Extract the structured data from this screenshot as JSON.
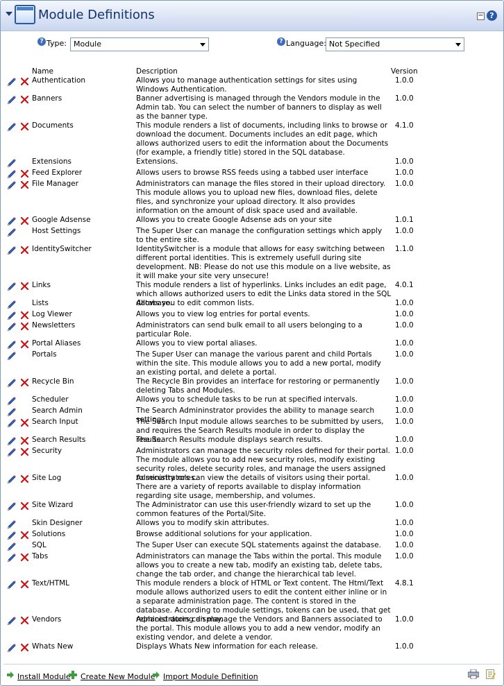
{
  "header": {
    "title": "Module Definitions",
    "minimize_label": "−",
    "help_label": "?"
  },
  "filters": {
    "type_label": "Type:",
    "type_value": "Module",
    "language_label": "Language:",
    "language_value": "Not Specified",
    "help_glyph": "?"
  },
  "columns": {
    "name": "Name",
    "description": "Description",
    "version": "Version"
  },
  "modules": [
    {
      "name": "Authentication",
      "description": "Allows you to manage authentication settings for sites using Windows Authentication.",
      "version": "1.0.0",
      "deletable": true
    },
    {
      "name": "Banners",
      "description": "Banner advertising is managed through the Vendors module in the Admin tab. You can select the number of banners to display as well as the banner type.",
      "version": "1.0.0",
      "deletable": true
    },
    {
      "name": "Documents",
      "description": "This module renders a list of documents, including links to browse or download the document. Documents includes an edit page, which allows authorized users to edit the information about the Documents (for example, a friendly title) stored in the SQL database.",
      "version": "4.1.0",
      "deletable": true
    },
    {
      "name": "Extensions",
      "description": "Extensions.",
      "version": "1.0.0",
      "deletable": false
    },
    {
      "name": "Feed Explorer",
      "description": "Allows users to browse RSS feeds using a tabbed user interface",
      "version": "1.0.0",
      "deletable": true
    },
    {
      "name": "File Manager",
      "description": "Administrators can manage the files stored in their upload directory. This module allows you to upload new files, download files, delete files, and synchronize your upload directory. It also provides information on the amount of disk space used and available.",
      "version": "1.0.0",
      "deletable": true
    },
    {
      "name": "Google Adsense",
      "description": "Allows you to create Google Adsense ads on your site",
      "version": "1.0.1",
      "deletable": true
    },
    {
      "name": "Host Settings",
      "description": "The Super User can manage the configuration settings which apply to the entire site.",
      "version": "1.0.0",
      "deletable": false
    },
    {
      "name": "IdentitySwitcher",
      "description": "IdentitySwitcher is a module that allows for easy switching between different portal identities. This is extremely usefull during site development. NB: Please do not use this module on a live website, as it will make your site very unsecure!",
      "version": "1.1.0",
      "deletable": true
    },
    {
      "name": "Links",
      "description": "This module renders a list of hyperlinks. Links includes an edit page, which allows authorized users to edit the Links data stored in the SQL database.",
      "version": "4.0.1",
      "deletable": true
    },
    {
      "name": "Lists",
      "description": "Allows you to edit common lists.",
      "version": "1.0.0",
      "deletable": false
    },
    {
      "name": "Log Viewer",
      "description": "Allows you to view log entries for portal events.",
      "version": "1.0.0",
      "deletable": true
    },
    {
      "name": "Newsletters",
      "description": "Administrators can send bulk email to all users belonging to a particular Role.",
      "version": "1.0.0",
      "deletable": true
    },
    {
      "name": "Portal Aliases",
      "description": "Allows you to view portal aliases.",
      "version": "1.0.0",
      "deletable": true
    },
    {
      "name": "Portals",
      "description": "The Super User can manage the various parent and child Portals within the site. This module allows you to add a new portal, modify an existing portal, and delete a portal.",
      "version": "1.0.0",
      "deletable": false
    },
    {
      "name": "Recycle Bin",
      "description": "The Recycle Bin provides an interface for restoring or permanently deleting Tabs and Modules.",
      "version": "1.0.0",
      "deletable": true
    },
    {
      "name": "Scheduler",
      "description": "Allows you to schedule tasks to be run at specified intervals.",
      "version": "1.0.0",
      "deletable": false
    },
    {
      "name": "Search Admin",
      "description": "The Search Admininstrator provides the ability to manage search settings.",
      "version": "1.0.0",
      "deletable": false
    },
    {
      "name": "Search Input",
      "description": "The Search Input module allows searches to be submitted by users, and requires the Search Results module in order to display the results.",
      "version": "1.0.0",
      "deletable": true
    },
    {
      "name": "Search Results",
      "description": "The Search Results module displays search results.",
      "version": "1.0.0",
      "deletable": true
    },
    {
      "name": "Security",
      "description": "Administrators can manage the security roles defined for their portal. The module allows you to add new security roles, modify existing security roles, delete security roles, and manage the users assigned to security roles.",
      "version": "1.0.0",
      "deletable": true
    },
    {
      "name": "Site Log",
      "description": "Administrators can view the details of visitors using their portal. There are a variety of reports available to display information regarding site usage, membership, and volumes.",
      "version": "1.0.0",
      "deletable": true
    },
    {
      "name": "Site Wizard",
      "description": "The Administrator can use this user-friendly wizard to set up the common features of the Portal/Site.",
      "version": "1.0.0",
      "deletable": true
    },
    {
      "name": "Skin Designer",
      "description": "Allows you to modify skin attributes.",
      "version": "1.0.0",
      "deletable": false
    },
    {
      "name": "Solutions",
      "description": "Browse additional solutions for your application.",
      "version": "1.0.0",
      "deletable": true
    },
    {
      "name": "SQL",
      "description": "The Super User can execute SQL statements against the database.",
      "version": "1.0.0",
      "deletable": false
    },
    {
      "name": "Tabs",
      "description": "Administrators can manage the Tabs within the portal. This module allows you to create a new tab, modify an existing tab, delete tabs, change the tab order, and change the hierarchical tab level.",
      "version": "1.0.0",
      "deletable": true
    },
    {
      "name": "Text/HTML",
      "description": "This module renders a block of HTML or Text content. The Html/Text module allows authorized users to edit the content either inline or in a separate administration page. The content is stored in the database. According to module settings, tokens can be used, that get replaced during display.",
      "version": "4.8.1",
      "deletable": true
    },
    {
      "name": "Vendors",
      "description": "Administrators can manage the Vendors and Banners associated to the portal. This module allows you to add a new vendor, modify an existing vendor, and delete a vendor.",
      "version": "1.0.0",
      "deletable": true
    },
    {
      "name": "Whats New",
      "description": "Displays Whats New information for each release.",
      "version": "1.0.0",
      "deletable": true
    }
  ],
  "footer": {
    "install_label": "Install Module",
    "create_label": "Create New Module",
    "import_label": "Import Module Definition"
  },
  "colors": {
    "header_text": "#11306e",
    "delete_icon": "#cc1111",
    "edit_icon": "#3060c0",
    "add_icon": "#3aa13a"
  }
}
